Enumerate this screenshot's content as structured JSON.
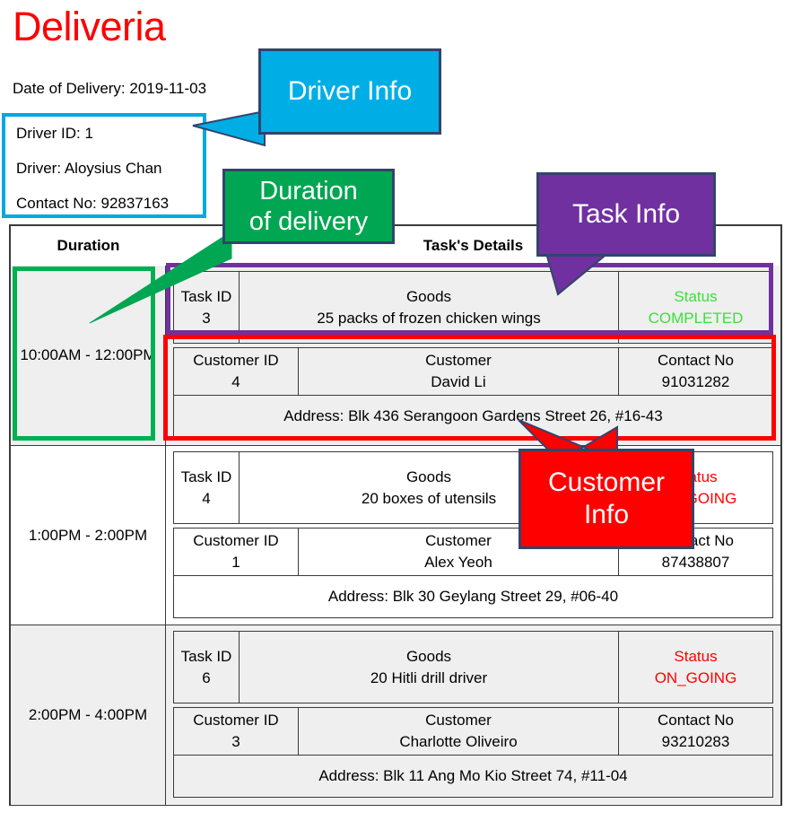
{
  "header": {
    "app_title": "Deliveria",
    "app_title_color": "#FF0000",
    "delivery_date": "Date of Delivery: 2019-11-03"
  },
  "driver": {
    "id_line": "Driver ID: 1",
    "name_line": "Driver: Aloysius Chan",
    "contact_line": "Contact No: 92837163",
    "highlight_color": "#00A9E0"
  },
  "callouts": {
    "driver_info": {
      "label": "Driver Info",
      "color": "#00AEE6"
    },
    "duration": {
      "line1": "Duration",
      "line2": "of delivery",
      "color": "#00A651"
    },
    "task_info": {
      "label": "Task Info",
      "color": "#7030A0"
    },
    "customer_info": {
      "line1": "Customer",
      "line2": "Info",
      "color": "#FF0000"
    }
  },
  "table": {
    "headers": {
      "duration": "Duration",
      "details": "Task's Details"
    },
    "sub_headers": {
      "task_id": "Task ID",
      "goods": "Goods",
      "status": "Status",
      "customer_id": "Customer ID",
      "customer": "Customer",
      "contact_no": "Contact No"
    },
    "rows": [
      {
        "duration": "10:00AM - 12:00PM",
        "task_id": "3",
        "goods": "25 packs of frozen chicken wings",
        "status": "COMPLETED",
        "status_color": "#3BE03B",
        "customer_id": "4",
        "customer": "David Li",
        "contact_no": "91031282",
        "address": "Address: Blk 436 Serangoon Gardens Street 26, #16-43"
      },
      {
        "duration": "1:00PM - 2:00PM",
        "task_id": "4",
        "goods": "20 boxes of utensils",
        "status": "ON_GOING",
        "status_color": "#FF0000",
        "customer_id": "1",
        "customer": "Alex Yeoh",
        "contact_no": "87438807",
        "address": "Address: Blk 30 Geylang Street 29, #06-40"
      },
      {
        "duration": "2:00PM - 4:00PM",
        "task_id": "6",
        "goods": "20 Hitli drill driver",
        "status": "ON_GOING",
        "status_color": "#FF0000",
        "customer_id": "3",
        "customer": "Charlotte Oliveiro",
        "contact_no": "93210283",
        "address": "Address: Blk 11 Ang Mo Kio Street 74, #11-04"
      }
    ]
  }
}
